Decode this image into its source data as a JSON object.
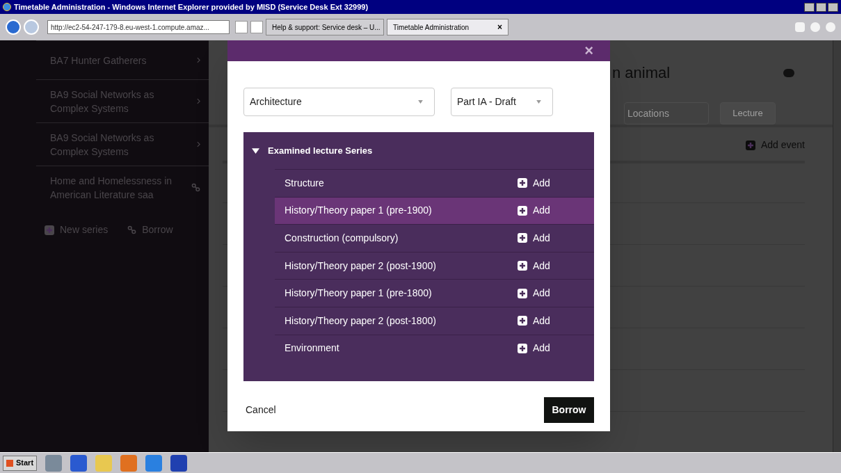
{
  "window": {
    "title": "Timetable Administration - Windows Internet Explorer provided by MISD (Service Desk Ext 32999)"
  },
  "browser": {
    "address": "http://ec2-54-247-179-8.eu-west-1.compute.amaz...",
    "tabs": [
      {
        "label": "Help & support: Service desk – U...",
        "selected": false
      },
      {
        "label": "Timetable Administration",
        "selected": true,
        "close": "×"
      }
    ]
  },
  "sidebar": {
    "items": [
      {
        "label": "BA7 Hunter Gatherers",
        "kind": "chevron"
      },
      {
        "label": "BA9 Social Networks as Complex Systems",
        "kind": "chevron"
      },
      {
        "label": "BA9 Social Networks as Complex Systems",
        "kind": "chevron"
      },
      {
        "label": "Home and Homelessness in American Literature saa",
        "kind": "link"
      }
    ],
    "actions": [
      {
        "label": "New series",
        "kind": "plus"
      },
      {
        "label": "Borrow",
        "kind": "link"
      }
    ]
  },
  "page": {
    "title": "n animal",
    "locations_placeholder": "Locations",
    "type_select": "Lecture",
    "add_event": "Add event"
  },
  "modal": {
    "close": "×",
    "department": "Architecture",
    "part": "Part IA - Draft",
    "group": {
      "label": "Examined lecture Series",
      "expanded": true,
      "items": [
        {
          "label": "Structure",
          "selected": false,
          "action": "Add"
        },
        {
          "label": "History/Theory paper 1 (pre-1900)",
          "selected": true,
          "action": "Add"
        },
        {
          "label": "Construction (compulsory)",
          "selected": false,
          "action": "Add"
        },
        {
          "label": "History/Theory paper 2 (post-1900)",
          "selected": false,
          "action": "Add"
        },
        {
          "label": "History/Theory paper 1 (pre-1800)",
          "selected": false,
          "action": "Add"
        },
        {
          "label": "History/Theory paper 2 (post-1800)",
          "selected": false,
          "action": "Add"
        },
        {
          "label": "Environment",
          "selected": false,
          "action": "Add"
        }
      ]
    },
    "cancel": "Cancel",
    "confirm": "Borrow"
  },
  "taskbar": {
    "start": "Start"
  }
}
